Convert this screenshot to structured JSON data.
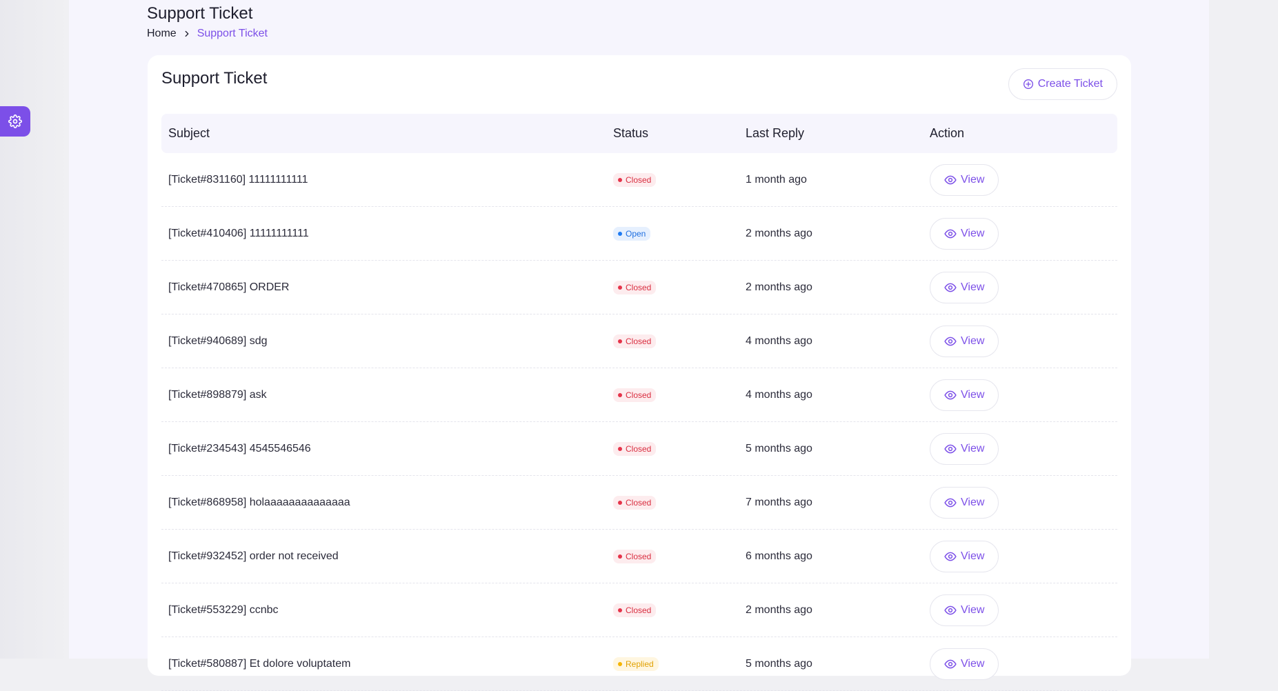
{
  "header": {
    "title": "Support Ticket",
    "breadcrumb": {
      "home": "Home",
      "current": "Support Ticket"
    }
  },
  "card": {
    "title": "Support Ticket",
    "create_label": "Create Ticket"
  },
  "table": {
    "columns": [
      "Subject",
      "Status",
      "Last Reply",
      "Action"
    ],
    "rows": [
      {
        "subject": "[Ticket#831160] 11111111111",
        "status": "Closed",
        "status_type": "closed",
        "last_reply": "1 month ago",
        "action": "View"
      },
      {
        "subject": "[Ticket#410406] 11111111111",
        "status": "Open",
        "status_type": "open",
        "last_reply": "2 months ago",
        "action": "View"
      },
      {
        "subject": "[Ticket#470865] ORDER",
        "status": "Closed",
        "status_type": "closed",
        "last_reply": "2 months ago",
        "action": "View"
      },
      {
        "subject": "[Ticket#940689] sdg",
        "status": "Closed",
        "status_type": "closed",
        "last_reply": "4 months ago",
        "action": "View"
      },
      {
        "subject": "[Ticket#898879] ask",
        "status": "Closed",
        "status_type": "closed",
        "last_reply": "4 months ago",
        "action": "View"
      },
      {
        "subject": "[Ticket#234543] 4545546546",
        "status": "Closed",
        "status_type": "closed",
        "last_reply": "5 months ago",
        "action": "View"
      },
      {
        "subject": "[Ticket#868958] holaaaaaaaaaaaaaa",
        "status": "Closed",
        "status_type": "closed",
        "last_reply": "7 months ago",
        "action": "View"
      },
      {
        "subject": "[Ticket#932452] order not received",
        "status": "Closed",
        "status_type": "closed",
        "last_reply": "6 months ago",
        "action": "View"
      },
      {
        "subject": "[Ticket#553229] ccnbc",
        "status": "Closed",
        "status_type": "closed",
        "last_reply": "2 months ago",
        "action": "View"
      },
      {
        "subject": "[Ticket#580887] Et dolore voluptatem",
        "status": "Replied",
        "status_type": "replied",
        "last_reply": "5 months ago",
        "action": "View"
      }
    ]
  },
  "colors": {
    "accent": "#7c4fe8",
    "closed": "#e5344a",
    "open": "#1f7bf2",
    "replied": "#f5b400"
  },
  "icons": {
    "settings": "gear-icon",
    "breadcrumb_separator": "chevron-right-icon",
    "create": "plus-circle-icon",
    "view": "eye-icon"
  }
}
